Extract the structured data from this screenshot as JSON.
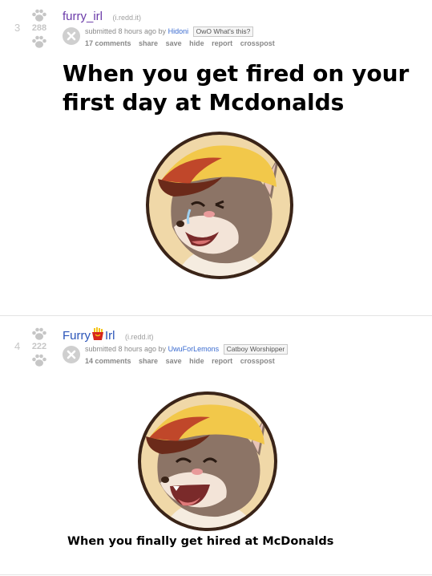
{
  "posts": [
    {
      "rank": "3",
      "score": "288",
      "title": "furry_irl",
      "title_parts": null,
      "domain": "(i.redd.it)",
      "submitted": "submitted 8 hours ago by",
      "author": "Hidoni",
      "flair": "OwO What's this?",
      "buttons": [
        "17 comments",
        "share",
        "save",
        "hide",
        "report",
        "crosspost"
      ],
      "meme_text": "When you get fired on your first day at Mcdonalds",
      "expression": "crying"
    },
    {
      "rank": "4",
      "score": "222",
      "title_parts": [
        "Furry",
        "Irl"
      ],
      "domain": "(i.redd.it)",
      "submitted": "submitted 8 hours ago by",
      "author": "UwuForLemons",
      "flair": "Catboy Worshipper",
      "buttons": [
        "14 comments",
        "share",
        "save",
        "hide",
        "report",
        "crosspost"
      ],
      "meme_text": "When you finally get hired at McDonalds",
      "expression": "happy"
    }
  ],
  "icons": {
    "vote": "paw-icon",
    "expand": "close-x-icon",
    "title_emblem": "fries-icon"
  },
  "colors": {
    "visited_title": "#6a3aa8",
    "title": "#2a54b8",
    "author": "#3a6bd0",
    "meta": "#8a8a8a",
    "vote_inactive": "#c6c6c6"
  }
}
